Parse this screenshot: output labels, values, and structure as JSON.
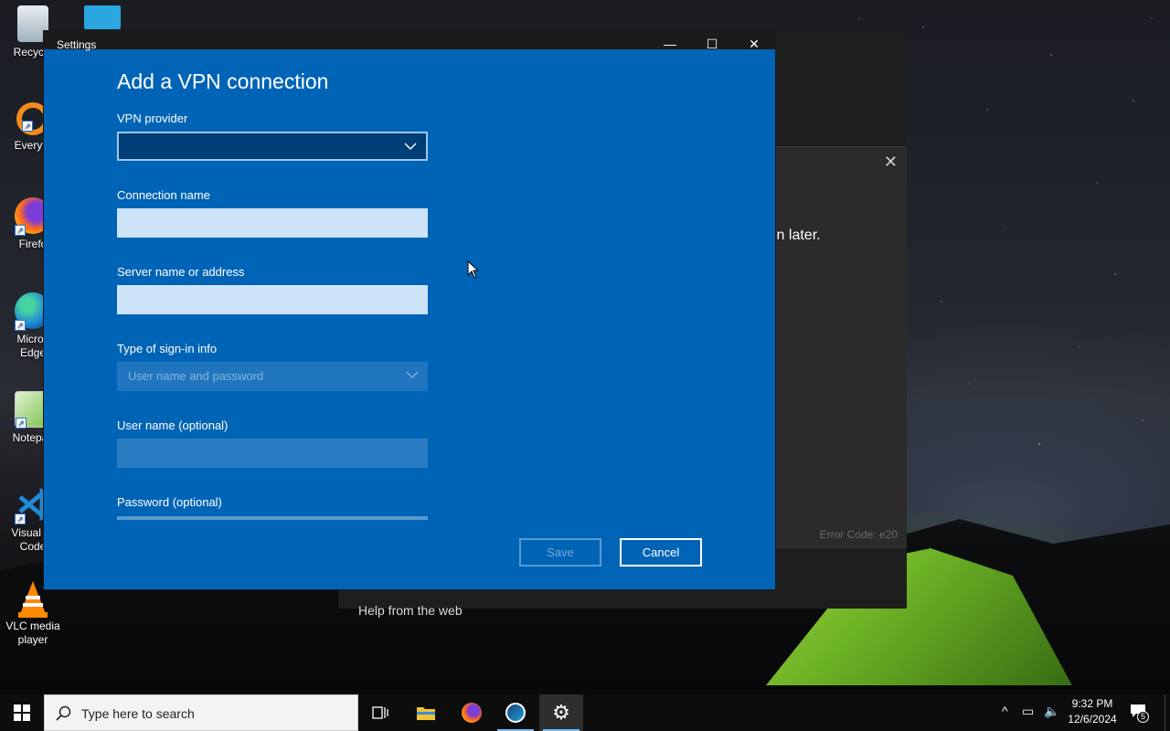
{
  "desktop": {
    "icons": [
      {
        "label": "Recycle",
        "icon": "recycle-bin-icon"
      },
      {
        "label": "Everyth",
        "icon": "everything-search-icon"
      },
      {
        "label": "Firefo",
        "icon": "firefox-icon"
      },
      {
        "label": "Micros Edge",
        "icon": "edge-icon"
      },
      {
        "label": "Notepac",
        "icon": "notepad-icon"
      },
      {
        "label": "Visual St Code",
        "icon": "vscode-icon"
      },
      {
        "label": "VLC media player",
        "icon": "vlc-icon"
      }
    ]
  },
  "background_window": {
    "message_fragment": "in later.",
    "error_code": "Error Code: e20",
    "help_fragment": "Help from the web"
  },
  "settings_window": {
    "title": "Settings",
    "minimize_symbol": "—",
    "maximize_symbol": "☐",
    "close_symbol": "✕",
    "dialog_title": "Add a VPN connection",
    "vpn_provider": {
      "label": "VPN provider",
      "value": ""
    },
    "connection_name": {
      "label": "Connection name",
      "value": ""
    },
    "server": {
      "label": "Server name or address",
      "value": ""
    },
    "sign_in_type": {
      "label": "Type of sign-in info",
      "value": "User name and password"
    },
    "username": {
      "label": "User name (optional)",
      "value": ""
    },
    "password": {
      "label": "Password (optional)",
      "value": ""
    },
    "save_label": "Save",
    "cancel_label": "Cancel"
  },
  "taskbar": {
    "search_placeholder": "Type here to search",
    "time": "9:32 PM",
    "date": "12/6/2024",
    "notification_count": "5"
  },
  "colors": {
    "accent": "#0064b6",
    "taskbar": "#0d0d0d"
  }
}
